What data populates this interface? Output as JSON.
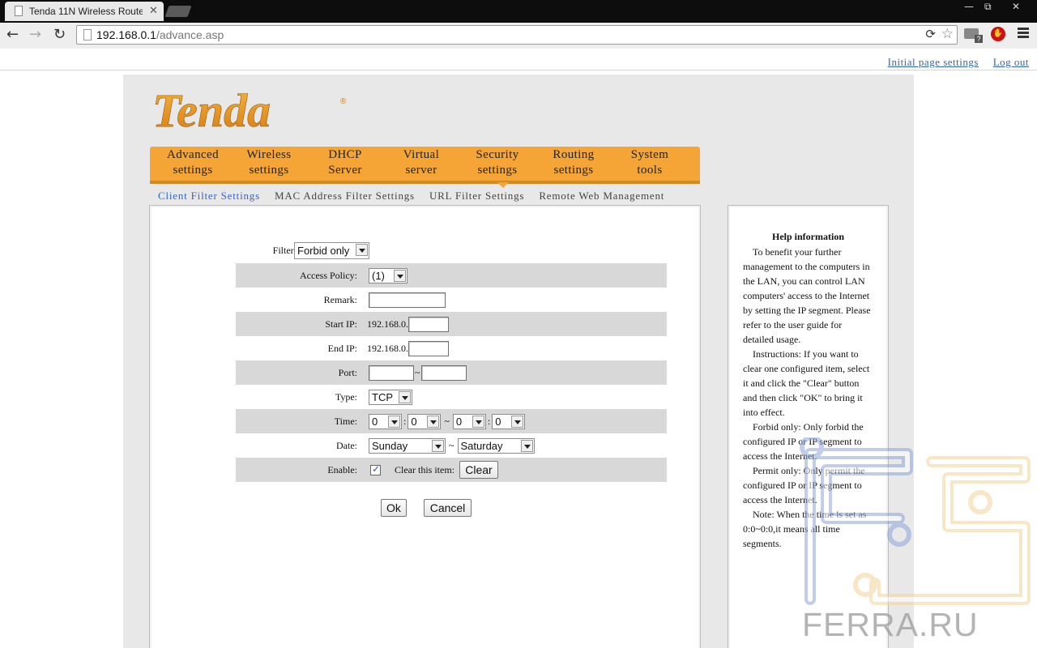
{
  "browser": {
    "tab_title": "Tenda 11N Wireless Router",
    "tab_close": "✕",
    "url_host": "192.168.0.1",
    "url_path": "/advance.asp",
    "window_min": "—",
    "window_restore": "⧉",
    "window_close": "✕",
    "back": "←",
    "forward": "→",
    "reload": "↻",
    "reload_alt": "⟳",
    "star": "☆"
  },
  "top_links": {
    "initial": "Initial page settings",
    "logout": "Log out"
  },
  "logo_text": "Tenda",
  "logo_mark": "®",
  "main_nav": [
    {
      "line1": "Advanced",
      "line2": "settings"
    },
    {
      "line1": "Wireless",
      "line2": "settings"
    },
    {
      "line1": "DHCP",
      "line2": "Server"
    },
    {
      "line1": "Virtual",
      "line2": "server"
    },
    {
      "line1": "Security",
      "line2": "settings"
    },
    {
      "line1": "Routing",
      "line2": "settings"
    },
    {
      "line1": "System",
      "line2": "tools"
    }
  ],
  "sub_nav": {
    "client": "Client Filter Settings",
    "mac": "MAC Address Filter Settings",
    "url": "URL Filter Settings",
    "remote": "Remote Web Management"
  },
  "form": {
    "filter_mode_label": "Filter Mode:",
    "filter_mode_value": "Forbid only",
    "access_policy_label": "Access Policy:",
    "access_policy_value": "(1)",
    "remark_label": "Remark:",
    "start_ip_label": "Start IP:",
    "start_ip_prefix": "192.168.0.",
    "end_ip_label": "End IP:",
    "end_ip_prefix": "192.168.0.",
    "port_label": "Port:",
    "port_sep": "~",
    "type_label": "Type:",
    "type_value": "TCP",
    "time_label": "Time:",
    "time_h1": "0",
    "time_m1": "0",
    "time_h2": "0",
    "time_m2": "0",
    "colon": ":",
    "tilde": "~",
    "date_label": "Date:",
    "date_from": "Sunday",
    "date_to": "Saturday",
    "enable_label": "Enable:",
    "clear_item_label": "Clear this item:",
    "clear_button": "Clear",
    "ok_button": "Ok",
    "cancel_button": "Cancel"
  },
  "help": {
    "title": "Help information",
    "p1": "To benefit your further management to the computers in the LAN, you can control LAN computers' access to the Internet by setting the IP segment. Please refer to the user guide for detailed usage.",
    "p2": "Instructions: If you want to clear one configured item, select it and click the \"Clear\" button and then click \"OK\" to bring it into effect.",
    "p3": "Forbid only: Only forbid the configured IP or IP segment to access the Internet.",
    "p4": "Permit only: Only permit the configured IP or IP segment to access the Internet.",
    "p5": "Note: When the time is set as 0:0~0:0,it means all time segments."
  },
  "watermark": "FERRA.RU",
  "colors": {
    "nav_orange": "#f4a535",
    "link_blue": "#3366cc",
    "panel_gray": "#e8e8e8"
  }
}
